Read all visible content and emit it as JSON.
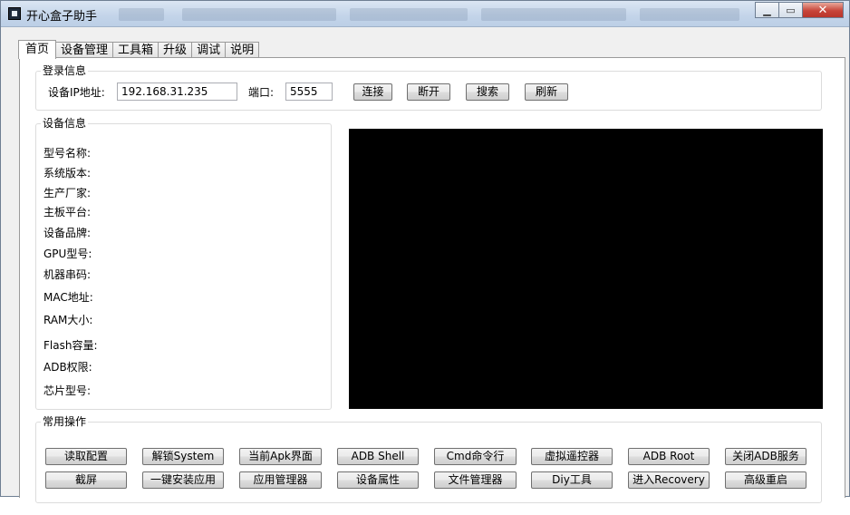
{
  "window": {
    "title": "开心盒子助手"
  },
  "tabs": [
    {
      "label": "首页"
    },
    {
      "label": "设备管理"
    },
    {
      "label": "工具箱"
    },
    {
      "label": "升级"
    },
    {
      "label": "调试"
    },
    {
      "label": "说明"
    }
  ],
  "login": {
    "title": "登录信息",
    "ip_label": "设备IP地址:",
    "ip_value": "192.168.31.235",
    "port_label": "端口:",
    "port_value": "5555",
    "connect": "连接",
    "disconnect": "断开",
    "search": "搜索",
    "refresh": "刷新"
  },
  "device_info": {
    "title": "设备信息",
    "fields": [
      "型号名称:",
      "系统版本:",
      "生产厂家:",
      "主板平台:",
      "设备品牌:",
      "GPU型号:",
      "机器串码:",
      "MAC地址:",
      "RAM大小:",
      "Flash容量:",
      "ADB权限:",
      "芯片型号:"
    ]
  },
  "common_ops": {
    "title": "常用操作",
    "row1": [
      "读取配置",
      "解锁System",
      "当前Apk界面",
      "ADB Shell",
      "Cmd命令行",
      "虚拟遥控器",
      "ADB  Root",
      "关闭ADB服务"
    ],
    "row2": [
      "截屏",
      "一键安装应用",
      "应用管理器",
      "设备属性",
      "文件管理器",
      "Diy工具",
      "进入Recovery",
      "高级重启"
    ]
  }
}
